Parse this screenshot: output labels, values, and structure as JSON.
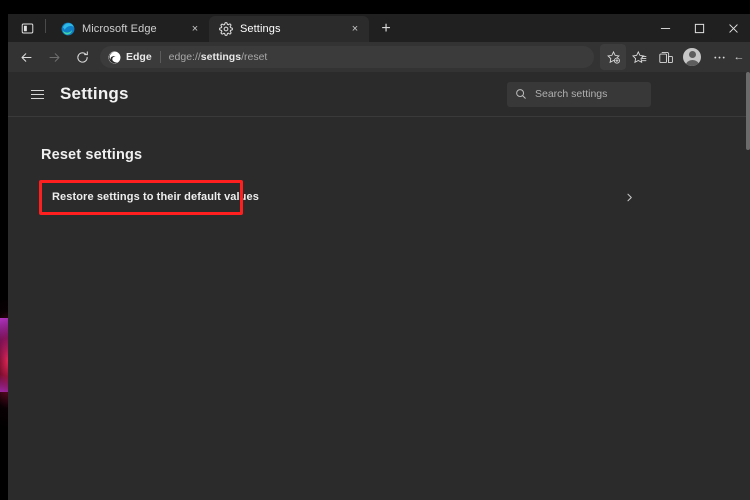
{
  "window": {
    "controls": {
      "minimize_label": "Minimize",
      "maximize_label": "Maximize",
      "close_label": "Close"
    }
  },
  "tabstrip": {
    "tab_list_button": "tab-actions",
    "new_tab_button": "+",
    "tabs": [
      {
        "title": "Microsoft Edge",
        "icon": "edge-logo-icon",
        "active": false,
        "close": "×"
      },
      {
        "title": "Settings",
        "icon": "gear-icon",
        "active": true,
        "close": "×"
      }
    ]
  },
  "toolbar": {
    "back_label": "Back",
    "forward_label": "Forward",
    "refresh_label": "Refresh",
    "omnibox": {
      "chip_label": "Edge",
      "url_prefix": "edge://",
      "url_highlight": "settings",
      "url_suffix": "/reset"
    },
    "add_favorite_label": "Add this page to favorites",
    "favorites_label": "Favorites",
    "collections_label": "Collections",
    "profile_label": "Profile",
    "settings_more_label": "Settings and more",
    "collapse_label": "←"
  },
  "settings": {
    "menu_label": "Settings menu",
    "title": "Settings",
    "search": {
      "placeholder": "Search settings",
      "icon": "search-icon"
    },
    "section": {
      "heading": "Reset settings",
      "row": {
        "label": "Restore settings to their default values",
        "chevron": "›",
        "highlighted": true
      }
    }
  },
  "colors": {
    "window_chrome": "#202020",
    "toolbar": "#333333",
    "page_bg": "#2b2b2b",
    "active_tab": "#2b2b2b",
    "omnibox": "#3b3b3b",
    "annotation_red": "#ff1f1f",
    "text_primary": "#f0f0f0",
    "text_secondary": "#a8a8a8"
  }
}
